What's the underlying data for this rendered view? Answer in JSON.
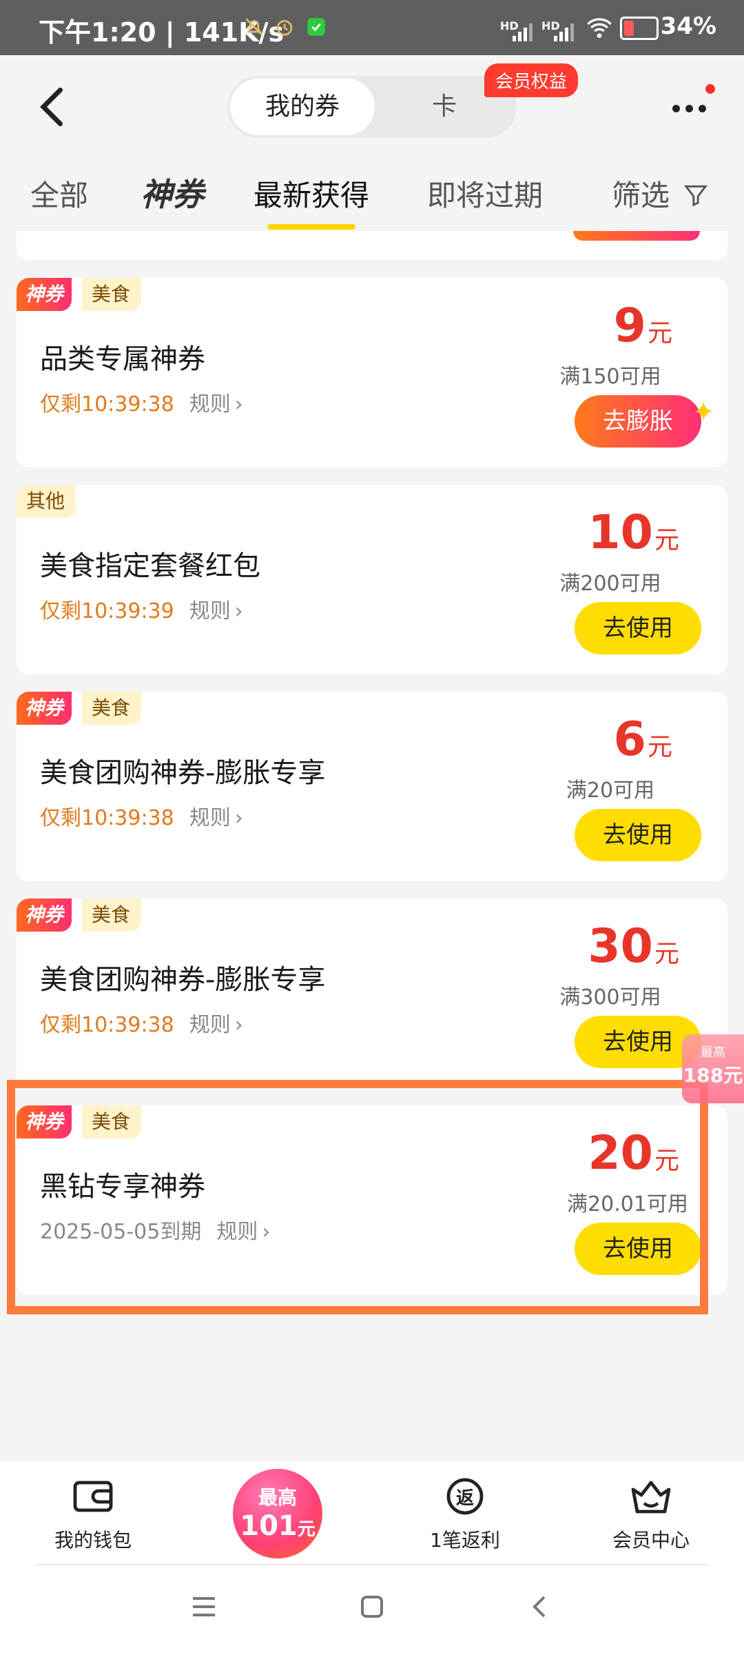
{
  "status_bar": {
    "time": "下午1:20 | 141K/s",
    "hd1": "HD",
    "hd2": "HD",
    "battery": "34%"
  },
  "header": {
    "segments": [
      "我的券",
      "卡"
    ],
    "member_badge": "会员权益",
    "tabs": [
      "全部",
      "神券",
      "最新获得",
      "即将过期",
      "筛选"
    ]
  },
  "coupons": [
    {
      "tag_shen": "神券",
      "tag_cat": "美食",
      "title": "品类专属神券",
      "remain": "仅剩10:39:38",
      "rule": "规则",
      "amount": "9",
      "unit": "元",
      "condition": "满150可用",
      "button": "去膨胀"
    },
    {
      "tag_cat": "其他",
      "title": "美食指定套餐红包",
      "remain": "仅剩10:39:39",
      "rule": "规则",
      "amount": "10",
      "unit": "元",
      "condition": "满200可用",
      "button": "去使用"
    },
    {
      "tag_shen": "神券",
      "tag_cat": "美食",
      "title": "美食团购神券-膨胀专享",
      "remain": "仅剩10:39:38",
      "rule": "规则",
      "amount": "6",
      "unit": "元",
      "condition": "满20可用",
      "button": "去使用"
    },
    {
      "tag_shen": "神券",
      "tag_cat": "美食",
      "title": "美食团购神券-膨胀专享",
      "remain": "仅剩10:39:38",
      "rule": "规则",
      "amount": "30",
      "unit": "元",
      "condition": "满300可用",
      "button": "去使用"
    },
    {
      "tag_shen": "神券",
      "tag_cat": "美食",
      "title": "黑钻专享神券",
      "expiry": "2025-05-05到期",
      "rule": "规则",
      "amount": "20",
      "unit": "元",
      "condition": "满20.01可用",
      "button": "去使用"
    }
  ],
  "float_badge": {
    "line1": "最高",
    "line2": "188元"
  },
  "bottom_nav": {
    "wallet": "我的钱包",
    "center_top": "最高",
    "center_value": "101",
    "center_unit": "元",
    "rebate": "1笔返利",
    "rebate_icon_text": "返",
    "member": "会员中心"
  },
  "colors": {
    "accent_yellow": "#ffdd00",
    "price_red": "#e8352a",
    "remain_orange": "#e07a1a",
    "highlight_border": "#ff7a3d"
  }
}
